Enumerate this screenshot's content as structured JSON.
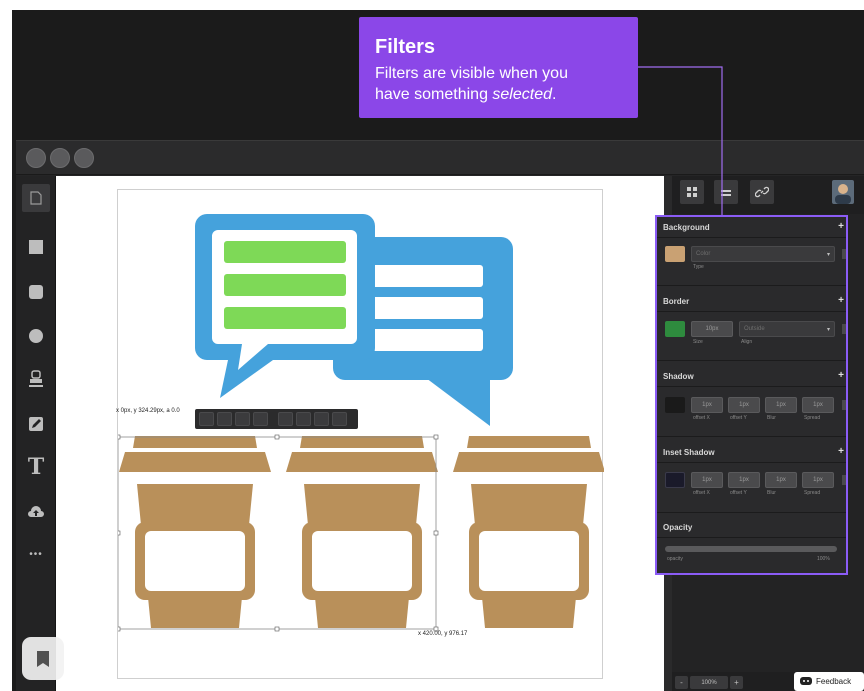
{
  "tooltip": {
    "title": "Filters",
    "body_line1": "Filters are visible when you",
    "body_line2_prefix": "have something ",
    "body_line2_em": "selected",
    "body_line2_suffix": "."
  },
  "left_toolbar": {
    "tools": [
      "page-icon",
      "rectangle-icon",
      "rounded-rect-icon",
      "circle-icon",
      "stamp-icon",
      "pencil-icon",
      "text-icon",
      "upload-icon",
      "more-icon"
    ],
    "text_tool_glyph": "T",
    "more_glyph": "•••"
  },
  "canvas": {
    "coord_top": "x 0px, y 324.29px, a 0.0",
    "coord_bottom": "x 420.00, y 976.17",
    "colors": {
      "bubble_blue": "#45a2dc",
      "bar_green": "#7ed957",
      "cup_brown": "#b9905a",
      "white": "#ffffff"
    }
  },
  "right_panel": {
    "tabs": [
      "grid-icon",
      "align-icon",
      "link-icon"
    ],
    "filters": {
      "background": {
        "title": "Background",
        "swatch": "#c9a173",
        "type_value": "Color",
        "type_label": "Type"
      },
      "border": {
        "title": "Border",
        "swatch": "#2e8b3e",
        "size_value": "10px",
        "size_label": "Size",
        "align_value": "Outside",
        "align_label": "Align"
      },
      "shadow": {
        "title": "Shadow",
        "swatch": "#1a1a1a",
        "fields": [
          {
            "value": "1px",
            "label": "offset X"
          },
          {
            "value": "1px",
            "label": "offset Y"
          },
          {
            "value": "1px",
            "label": "Blur"
          },
          {
            "value": "1px",
            "label": "Spread"
          }
        ]
      },
      "inset_shadow": {
        "title": "Inset Shadow",
        "swatch": "#1a1a2a",
        "fields": [
          {
            "value": "1px",
            "label": "offset X"
          },
          {
            "value": "1px",
            "label": "offset Y"
          },
          {
            "value": "1px",
            "label": "Blur"
          },
          {
            "value": "1px",
            "label": "Spread"
          }
        ]
      },
      "opacity": {
        "title": "Opacity",
        "label": "opacity",
        "value_label": "100%"
      },
      "plus_glyph": "+"
    }
  },
  "bottom_bar": {
    "zoom": "100%",
    "minus": "-",
    "plus": "+"
  },
  "feedback": {
    "label": "Feedback"
  },
  "accent_color": "#8b47e8"
}
